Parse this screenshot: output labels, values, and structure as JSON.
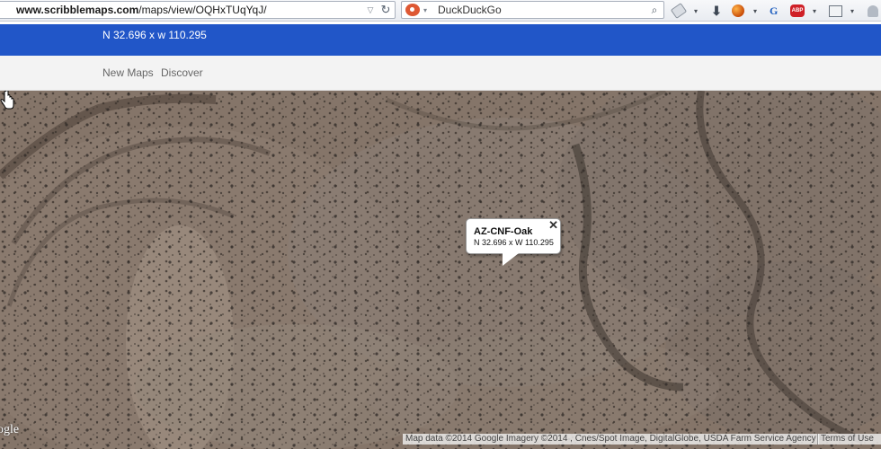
{
  "browser": {
    "url_bold": "www.scribblemaps.com",
    "url_rest": "/maps/view/OQHxTUqYqJ/",
    "search_value": "DuckDuckGo"
  },
  "header": {
    "coords": "N 32.696 x w 110.295"
  },
  "nav": {
    "items": [
      "New Maps",
      "Discover"
    ]
  },
  "map": {
    "infowindow": {
      "title": "AZ-CNF-Oak",
      "coords": "N 32.696 x W 110.295",
      "close_glyph": "✕"
    },
    "logo": "ogle",
    "attribution": "Map data ©2014 Google Imagery ©2014 , Cnes/Spot Image, DigitalGlobe, USDA Farm Service Agency",
    "terms": "Terms of Use"
  },
  "icons": [
    "tag-icon",
    "download-icon",
    "firefox-ball-icon",
    "gc-icon",
    "adblock-icon",
    "screenshot-icon",
    "bell-icon"
  ]
}
